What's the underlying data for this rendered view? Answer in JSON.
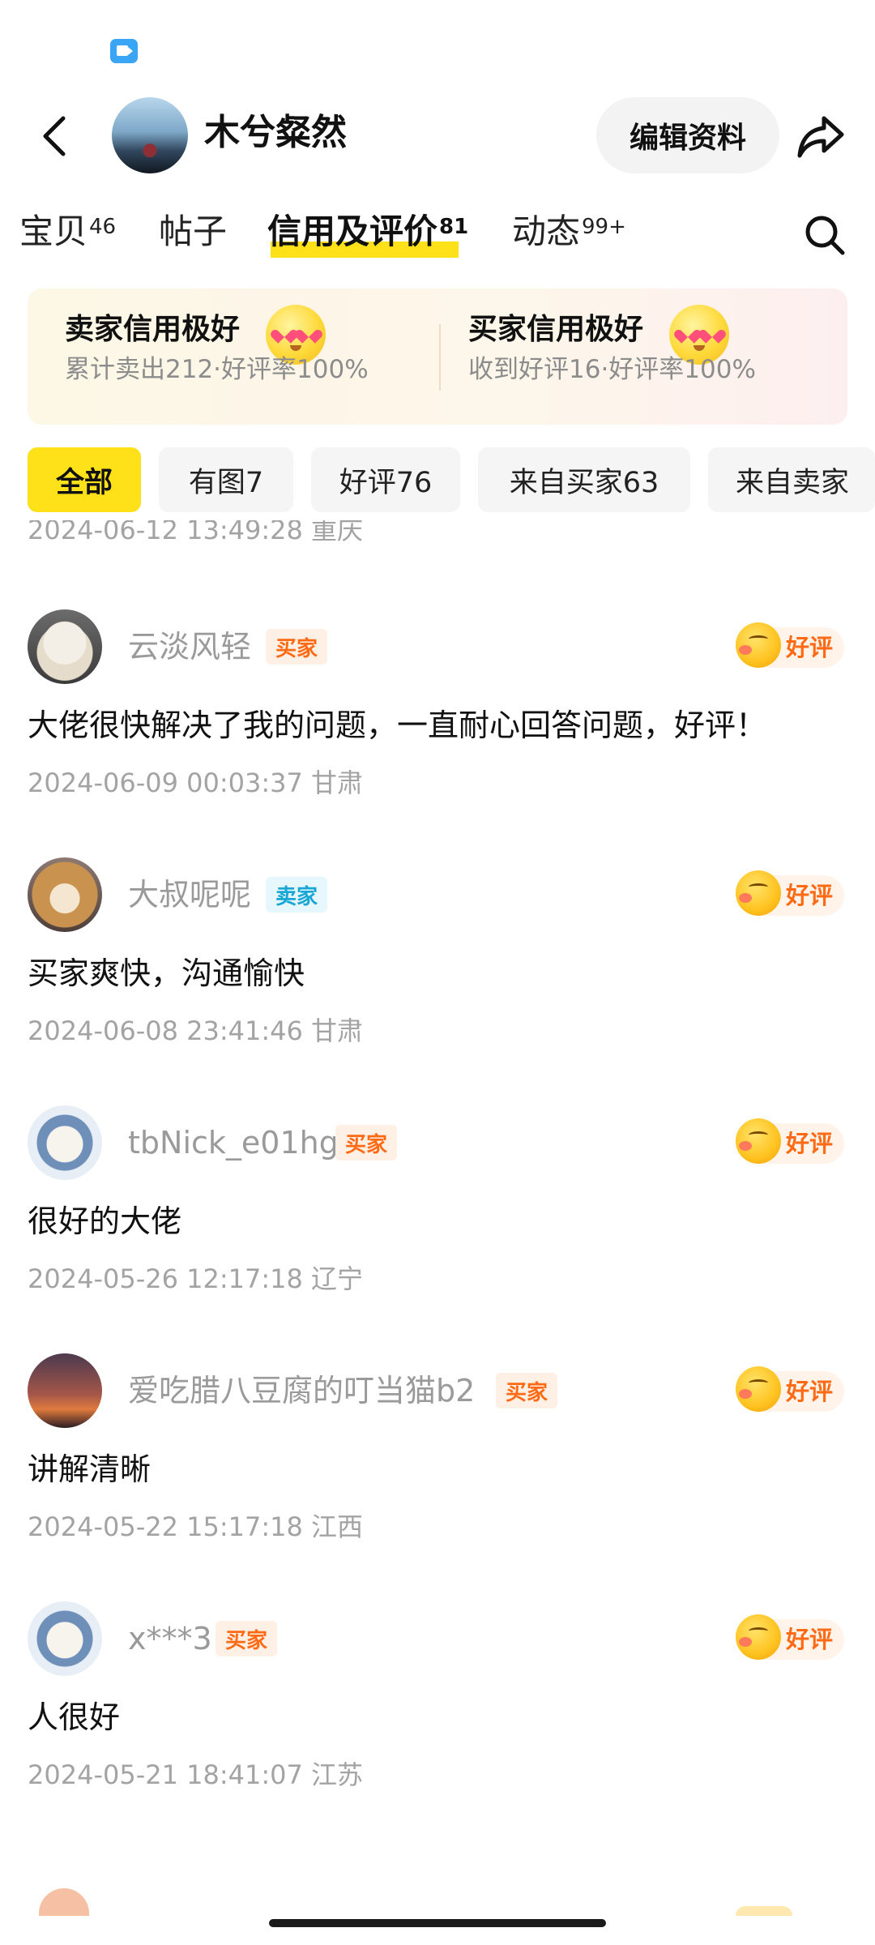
{
  "header": {
    "profile_name": "木兮粲然",
    "edit_button_label": "编辑资料"
  },
  "tabs": [
    {
      "label": "宝贝",
      "count": "46"
    },
    {
      "label": "帖子",
      "count": ""
    },
    {
      "label": "信用及评价",
      "count": "81"
    },
    {
      "label": "动态",
      "count": "99+"
    }
  ],
  "credit": {
    "seller_title": "卖家信用极好",
    "seller_sub": "累计卖出212·好评率100%",
    "buyer_title": "买家信用极好",
    "buyer_sub": "收到好评16·好评率100%"
  },
  "filters": [
    "全部",
    "有图7",
    "好评76",
    "来自买家63",
    "来自卖家"
  ],
  "partial_top_meta": "2024-06-12 13:49:28 重庆",
  "reviews": [
    {
      "name": "云淡风轻",
      "role": "买家",
      "rating": "好评",
      "content": "大佬很快解决了我的问题，一直耐心回答问题，好评！",
      "meta": "2024-06-09 00:03:37  甘肃"
    },
    {
      "name": "大叔呢呢",
      "role": "卖家",
      "rating": "好评",
      "content": "买家爽快，沟通愉快",
      "meta": "2024-06-08 23:41:46  甘肃"
    },
    {
      "name": "tbNick_e01hg",
      "role": "买家",
      "rating": "好评",
      "content": "很好的大佬",
      "meta": "2024-05-26 12:17:18  辽宁"
    },
    {
      "name": "爱吃腊八豆腐的叮当猫b2",
      "role": "买家",
      "rating": "好评",
      "content": "讲解清晰",
      "meta": "2024-05-22 15:17:18  江西"
    },
    {
      "name": "x***3",
      "role": "买家",
      "rating": "好评",
      "content": "人很好",
      "meta": "2024-05-21 18:41:07  江苏"
    }
  ],
  "colors": {
    "accent_yellow": "#ffe11a",
    "buyer_orange": "#ff6a14",
    "seller_blue": "#18a6d6",
    "muted_text": "#a3a3a3"
  }
}
